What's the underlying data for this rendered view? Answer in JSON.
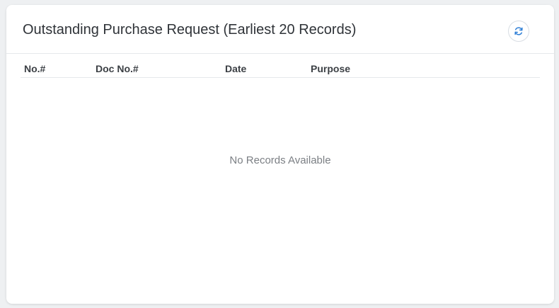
{
  "panel": {
    "title": "Outstanding Purchase Request (Earliest 20 Records)",
    "refresh_icon": "refresh-icon",
    "accent_color": "#2f7fd6"
  },
  "table": {
    "columns": [
      "No.#",
      "Doc No.#",
      "Date",
      "Purpose"
    ],
    "rows": [],
    "empty_text": "No Records Available"
  }
}
